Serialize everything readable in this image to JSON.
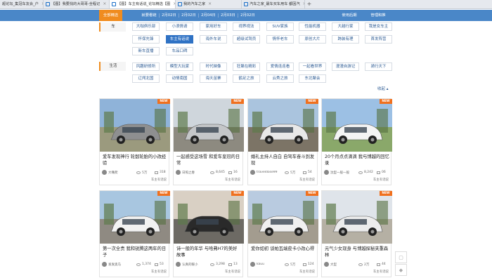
{
  "browser_tabs": [
    {
      "label": "超论坛_集冠车友会_户",
      "active": false
    },
    {
      "label": "【图】我要找的大哥哥-全程记",
      "active": false
    },
    {
      "label": "【图】车主有话说_论坛精选【图",
      "active": true
    },
    {
      "label": "我的汽车之家",
      "active": false
    },
    {
      "label": "汽车之家_最车买车用车 都因汽",
      "active": false
    }
  ],
  "nav": {
    "items": [
      "全部精选",
      "就要看链",
      "2月02日",
      "2月02日",
      "2月04日",
      "2月03日",
      "2月02日"
    ],
    "right": [
      "使用后期",
      "管理和推"
    ]
  },
  "categories": [
    {
      "label": "车"
    },
    {
      "label": "生活"
    }
  ],
  "car_tags": [
    "大咖俱乐部",
    "小浪情请",
    "家用好车",
    "视界视法",
    "SUV家族",
    "性能机器",
    "大越行家",
    "我是女车主",
    "怀保先锋",
    "车主有话说",
    "海外车说",
    "超级试驾员",
    "情怀老车",
    "原创大片",
    "跨装有理",
    "首发阵营",
    "新车直播",
    "车品口碑"
  ],
  "life_tags": [
    "风趣研修所",
    "模型大玩家",
    "时代映像",
    "狂聚在精彩",
    "爱情连连看",
    "一起看世界",
    "漫漫自游记",
    "骑行天下",
    "辽闯北国",
    "动情南国",
    "海天苗寨",
    "鹤足之旅",
    "云秀之旅",
    "东北聚会"
  ],
  "collapse_label": "收起 ▴",
  "cards": [
    {
      "title": "爱车发现神行 轮毂轮胎的小改经验",
      "author": "大嘴爬",
      "views": "5万",
      "comments": "318",
      "source": "车主有话说",
      "badge": "NEW"
    },
    {
      "title": "一起感受这场雪 和爱车皇冠的日常",
      "author": "日照之春",
      "views": "8,645",
      "comments": "16",
      "source": "车主有话说",
      "badge": "NEW"
    },
    {
      "title": "婚礼主持人自白 自驾车奋斗到发现",
      "author": "traveldose99",
      "views": "5万",
      "comments": "54",
      "source": "车主有话说",
      "badge": "NEW"
    },
    {
      "title": "20个月点点滴滴 我与博越的回忆录",
      "author": "沈型一般一般",
      "views": "8,242",
      "comments": "06",
      "source": "车主有话说",
      "badge": "NEW"
    },
    {
      "title": "第一次全责 我和锐腾这两年的日子",
      "author": "发发奥马",
      "views": "1,374",
      "comments": "53",
      "source": "车主有话说",
      "badge": "NEW"
    },
    {
      "title": "诗一般的年华 与哈弗H7的美好故事",
      "author": "认真的暖小",
      "views": "3,298",
      "comments": "13",
      "source": "车主有话说",
      "badge": "NEW"
    },
    {
      "title": "爱你如初 谈帕瓦端皮卡小改心得",
      "author": "kauu",
      "views": "5万",
      "comments": "124",
      "source": "车主有话说",
      "badge": "NEW"
    },
    {
      "title": "元气少女现身 与博越探秘夹重森林",
      "author": "大型",
      "views": "2万",
      "comments": "44",
      "source": "车主有话说",
      "badge": "NEW"
    }
  ],
  "float_buttons": [
    {
      "icon": "feedback-icon"
    },
    {
      "icon": "top-icon"
    }
  ],
  "colors": {
    "nav": "#4a87c8",
    "accent": "#f08c1f",
    "selected": "#2f72c4",
    "badge": "#f0701e"
  }
}
